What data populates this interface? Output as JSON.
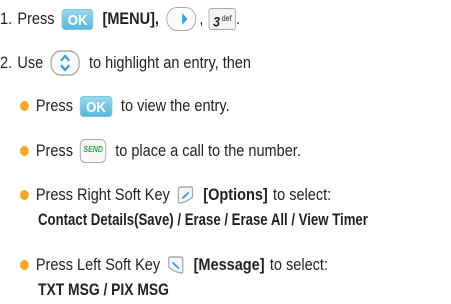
{
  "step1": {
    "number": "1.",
    "press": "Press",
    "ok_key": "OK",
    "menu": "[MENU],",
    "comma": ",",
    "key3_digit": "3",
    "key3_letters": "def",
    "period": "."
  },
  "step2": {
    "number": "2.",
    "use": "Use",
    "rest": "to highlight an entry, then"
  },
  "bullets": [
    {
      "press": "Press",
      "ok_key": "OK",
      "text": "to view the entry."
    },
    {
      "press": "Press",
      "send_key": "SEND",
      "text": "to place a call to the number."
    },
    {
      "press": "Press Right Soft Key",
      "bold": "[Options]",
      "text": "to select:",
      "options": "Contact Details(Save) / Erase / Erase All / View Timer"
    },
    {
      "press": "Press Left Soft Key",
      "bold": "[Message]",
      "text": "to select:",
      "options": "TXT MSG / PIX MSG"
    }
  ],
  "colors": {
    "bullet": "#f6a623",
    "ok_key": "#58b8dc",
    "send_text": "#2aa84a",
    "key_border": "#a7a9ac"
  }
}
